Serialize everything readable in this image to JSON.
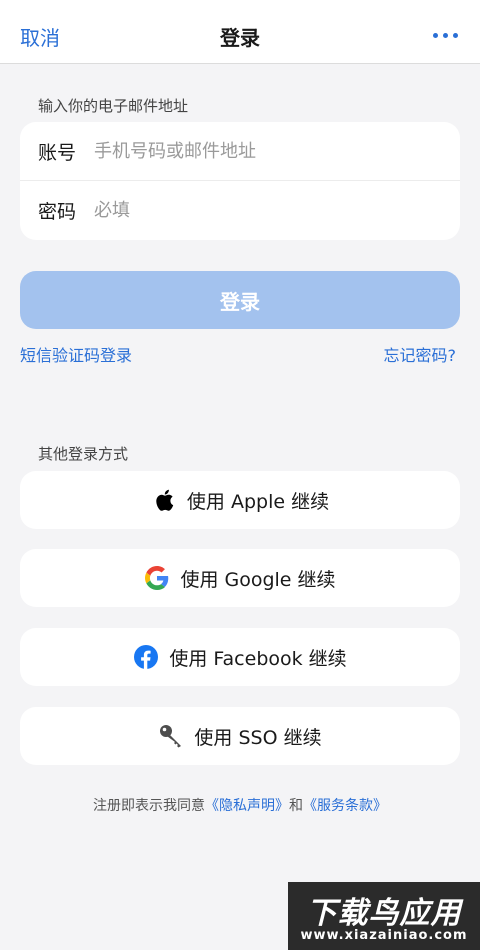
{
  "navbar": {
    "cancel_label": "取消",
    "title": "登录",
    "more_icon": "more-horizontal-icon"
  },
  "form": {
    "section_label": "输入你的电子邮件地址",
    "account_label": "账号",
    "account_placeholder": "手机号码或邮件地址",
    "account_value": "",
    "password_label": "密码",
    "password_placeholder": "必填",
    "password_value": ""
  },
  "login_button": {
    "label": "登录",
    "state": "disabled"
  },
  "links": {
    "sms_login": "短信验证码登录",
    "forgot_password": "忘记密码?"
  },
  "other_methods": {
    "section_label": "其他登录方式",
    "apple": "使用 Apple 继续",
    "google": "使用 Google 继续",
    "facebook": "使用 Facebook 继续",
    "sso": "使用 SSO 继续"
  },
  "terms": {
    "prefix": "注册即表示我同意",
    "privacy": "《隐私声明》",
    "and": "和",
    "service": "《服务条款》"
  },
  "watermark": {
    "title": "下载鸟应用",
    "url": "www.xiazainiao.com"
  },
  "colors": {
    "accent": "#2a6fd6",
    "button_disabled": "#a3c2ee",
    "background": "#f4f4f6",
    "facebook": "#1877f2"
  }
}
